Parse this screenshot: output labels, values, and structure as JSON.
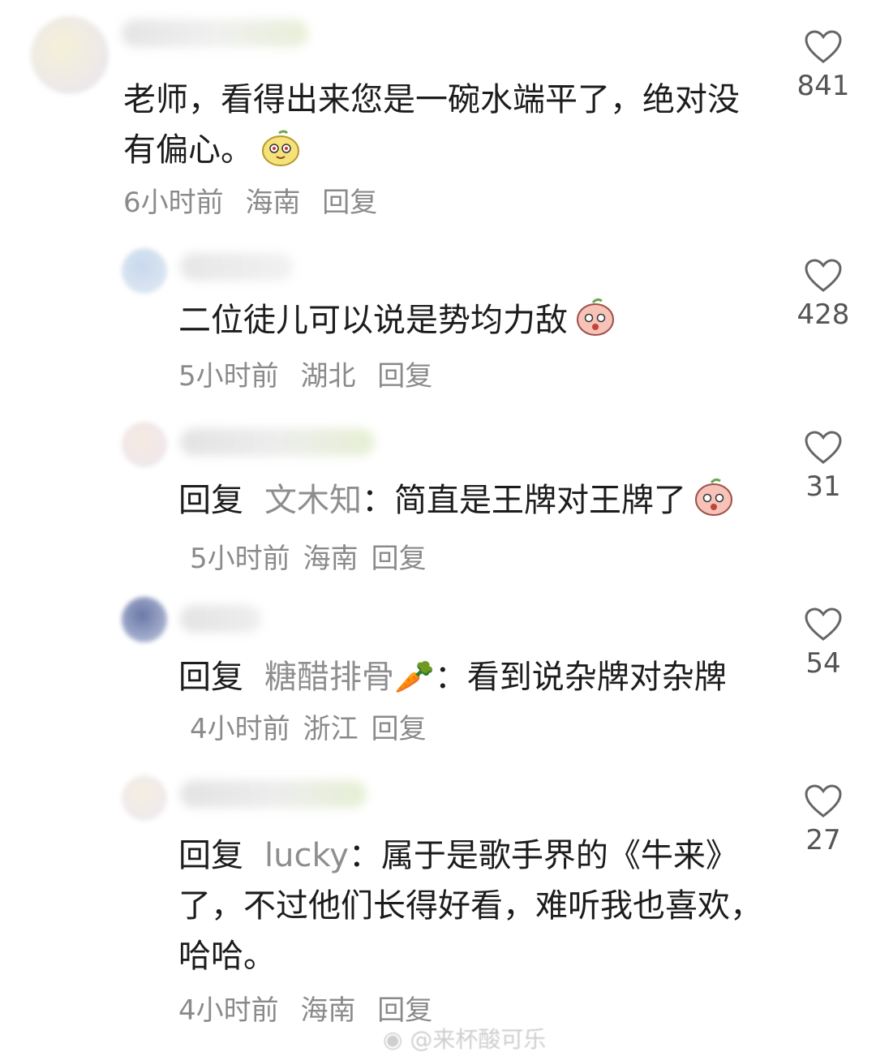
{
  "comments": [
    {
      "text": "老师，看得出来您是一碗水端平了，绝对没有偏心。",
      "time": "6小时前",
      "location": "海南",
      "reply_label": "回复",
      "likes": "841",
      "emoji": "lemon-face-emoji"
    },
    {
      "text": "二位徒儿可以说是势均力敌",
      "time": "5小时前",
      "location": "湖北",
      "reply_label": "回复",
      "likes": "428",
      "emoji": "peach-face-emoji"
    },
    {
      "reply_prefix": "回复",
      "reply_to": "文木知",
      "text": "：简直是王牌对王牌了",
      "time": "5小时前",
      "location": "海南",
      "reply_label": "回复",
      "likes": "31",
      "emoji": "peach-face-emoji"
    },
    {
      "reply_prefix": "回复",
      "reply_to": "糖醋排骨🥕",
      "text": "：看到说杂牌对杂牌",
      "time": "4小时前",
      "location": "浙江",
      "reply_label": "回复",
      "likes": "54"
    },
    {
      "reply_prefix": "回复",
      "reply_to": "lucky",
      "text": "：属于是歌手界的《牛来》了，不过他们长得好看，难听我也喜欢，哈哈。",
      "time": "4小时前",
      "location": "海南",
      "reply_label": "回复",
      "likes": "27"
    }
  ],
  "watermark": "@来杯酸可乐",
  "colors": {
    "like_icon": "#666666",
    "meta_text": "#8a8a8a"
  }
}
